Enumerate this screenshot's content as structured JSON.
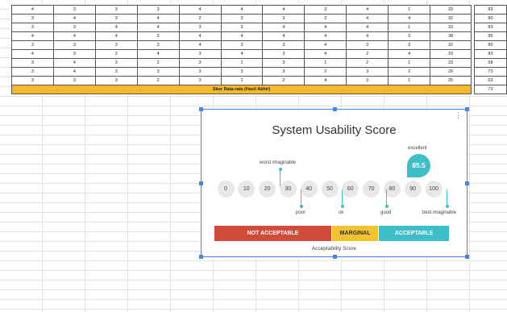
{
  "table": {
    "rows": [
      [
        "4",
        "3",
        "3",
        "3",
        "4",
        "4",
        "4",
        "3",
        "4",
        "1",
        "33",
        "83"
      ],
      [
        "3",
        "4",
        "3",
        "4",
        "2",
        "3",
        "3",
        "2",
        "4",
        "4",
        "32",
        "80"
      ],
      [
        "3",
        "3",
        "4",
        "4",
        "3",
        "3",
        "4",
        "4",
        "4",
        "1",
        "33",
        "83"
      ],
      [
        "4",
        "4",
        "4",
        "3",
        "4",
        "4",
        "4",
        "4",
        "4",
        "3",
        "38",
        "95"
      ],
      [
        "3",
        "3",
        "3",
        "3",
        "4",
        "3",
        "3",
        "4",
        "3",
        "3",
        "32",
        "80"
      ],
      [
        "4",
        "3",
        "2",
        "4",
        "3",
        "4",
        "3",
        "4",
        "2",
        "4",
        "33",
        "83"
      ],
      [
        "3",
        "4",
        "3",
        "2",
        "3",
        "1",
        "3",
        "1",
        "2",
        "1",
        "23",
        "58"
      ],
      [
        "3",
        "4",
        "3",
        "3",
        "3",
        "3",
        "3",
        "2",
        "3",
        "2",
        "29",
        "73"
      ],
      [
        "3",
        "3",
        "3",
        "2",
        "3",
        "1",
        "2",
        "4",
        "3",
        "1",
        "25",
        "63"
      ]
    ],
    "average_label": "Skor Rata-rata (Hasil Akhir)",
    "average_value": "73"
  },
  "chart": {
    "more_icon": "more-vert-icon",
    "title": "System Usability Score",
    "ticks": [
      "0",
      "10",
      "20",
      "30",
      "40",
      "50",
      "60",
      "70",
      "80",
      "90",
      "100"
    ],
    "labels": {
      "worst": "worst imaginable",
      "poor": "poor",
      "ok": "ok",
      "good": "good",
      "excellent": "excellent",
      "best": "best imaginable"
    },
    "score": "85.5",
    "bands": {
      "not_acceptable": "NOT ACCEPTABLE",
      "marginal": "MARGINAL",
      "acceptable": "ACCEPTABLE"
    },
    "caption": "Acceptability Score",
    "colors": {
      "accent": "#3ebec7",
      "not_acceptable": "#d14b3a",
      "marginal": "#f2c230",
      "acceptable": "#3ebec7",
      "selection": "#4285f4"
    }
  }
}
